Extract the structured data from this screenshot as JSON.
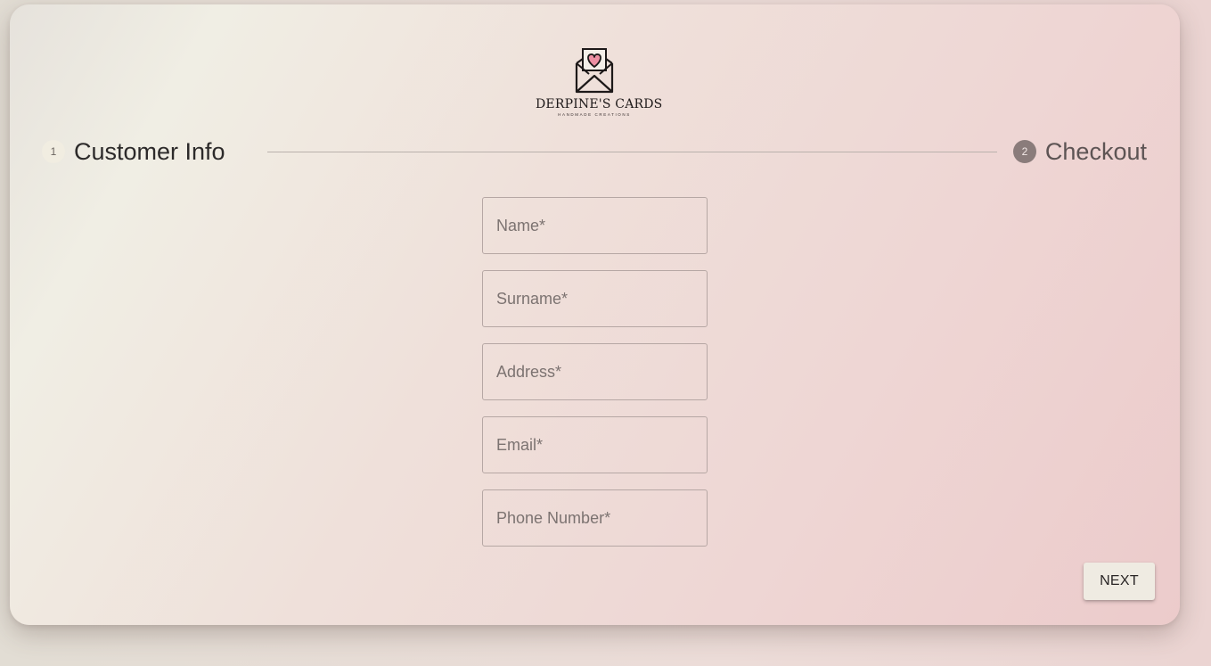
{
  "logo": {
    "name": "DERPINE'S CARDS",
    "tagline": "HANDMADE CREATIONS"
  },
  "stepper": {
    "steps": [
      {
        "number": "1",
        "label": "Customer Info",
        "state": "active"
      },
      {
        "number": "2",
        "label": "Checkout",
        "state": "inactive"
      }
    ]
  },
  "form": {
    "name_placeholder": "Name*",
    "surname_placeholder": "Surname*",
    "address_placeholder": "Address*",
    "email_placeholder": "Email*",
    "phone_placeholder": "Phone Number*"
  },
  "actions": {
    "next_label": "NEXT"
  },
  "colors": {
    "heart": "#ee8fa3",
    "active_step_circle": "#f1ede1",
    "inactive_step_circle": "#8a7c7b",
    "button_bg": "#efebe2"
  }
}
